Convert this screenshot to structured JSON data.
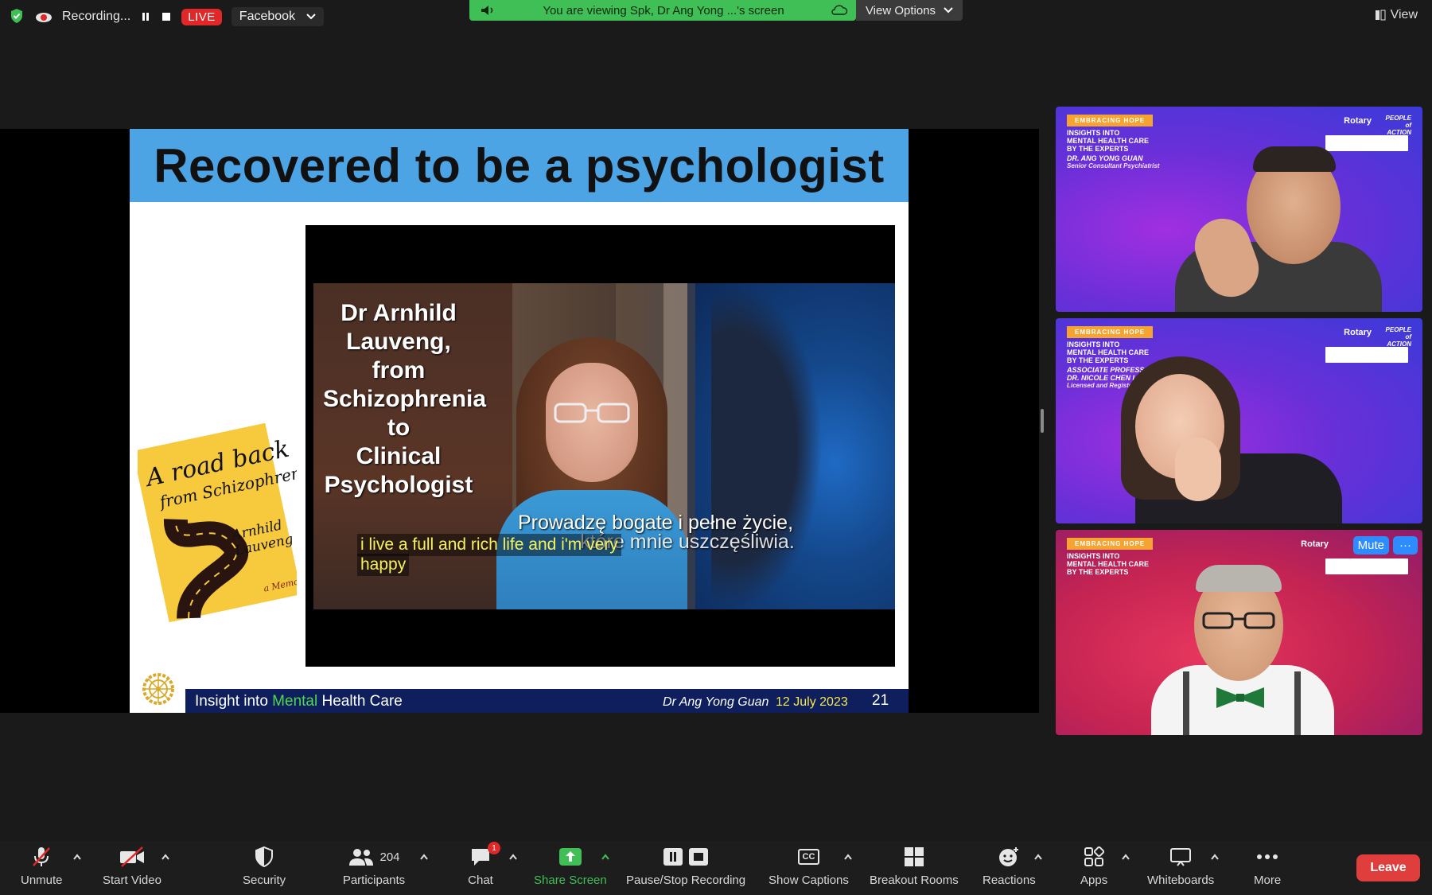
{
  "topbar": {
    "recording_label": "Recording...",
    "live_label": "LIVE",
    "stream_target": "Facebook",
    "view_label": "View"
  },
  "share_banner": {
    "text": "You are viewing Spk, Dr Ang Yong ...'s screen",
    "view_options": "View Options"
  },
  "slide": {
    "title": "Recovered to be a psychologist",
    "video_caption": [
      "Dr Arnhild",
      "Lauveng,",
      "from",
      "Schizophrenia",
      "to",
      "Clinical",
      "Psychologist"
    ],
    "polish_line_1": "Prowadzę bogate i pełne życie,",
    "polish_line_2": "które mnie uszczęśliwia.",
    "english_line_1": "i live a full and rich life and i'm very",
    "english_line_2": "happy",
    "book_title": "A road back from Schizophrenia",
    "book_author": "Arnhild Lauveng",
    "book_subtitle": "a Memoir",
    "footer_left_pre": "Insight into ",
    "footer_left_highlight": "Mental",
    "footer_left_post": " Health Care",
    "footer_author": "Dr Ang Yong Guan",
    "footer_date": "12 July 2023",
    "footer_page": "21"
  },
  "tiles": [
    {
      "tag": "EMBRACING HOPE",
      "info_lines": [
        "INSIGHTS INTO",
        "MENTAL HEALTH CARE",
        "BY THE EXPERTS"
      ],
      "name": "DR. ANG YONG GUAN",
      "role": "Senior Consultant Psychiatrist",
      "rotary": "Rotary",
      "people_of_action": "PEOPLE of ACTION"
    },
    {
      "tag": "EMBRACING HOPE",
      "info_lines": [
        "INSIGHTS INTO",
        "MENTAL HEALTH CARE",
        "BY THE EXPERTS"
      ],
      "name_line_1": "ASSOCIATE PROFESSOR",
      "name_line_2": "DR. NICOLE CHEN L",
      "role": "Licensed and Registered C",
      "rotary": "Rotary",
      "people_of_action": "PEOPLE of ACTION"
    },
    {
      "tag": "EMBRACING HOPE",
      "info_lines": [
        "INSIGHTS INTO",
        "MENTAL HEALTH CARE",
        "BY THE EXPERTS"
      ],
      "rotary": "Rotary",
      "mute_label": "Mute",
      "more_label": "···"
    }
  ],
  "toolbar": {
    "unmute": "Unmute",
    "start_video": "Start Video",
    "security": "Security",
    "participants": "Participants",
    "participant_count": "204",
    "chat": "Chat",
    "chat_badge": "1",
    "share_screen": "Share Screen",
    "pause_stop_recording": "Pause/Stop Recording",
    "show_captions": "Show Captions",
    "captions_icon_text": "CC",
    "breakout_rooms": "Breakout Rooms",
    "reactions": "Reactions",
    "apps": "Apps",
    "whiteboards": "Whiteboards",
    "more": "More",
    "leave": "Leave"
  },
  "colors": {
    "background": "#1a1a1a",
    "share_banner": "#3fbf55",
    "live_red": "#e02828",
    "leave_red": "#e03d3d",
    "slide_header_blue": "#4da4e4",
    "slide_footer_navy": "#0f1e5c",
    "share_screen_green": "#3fbf55",
    "accent_blue": "#2d8cff"
  }
}
